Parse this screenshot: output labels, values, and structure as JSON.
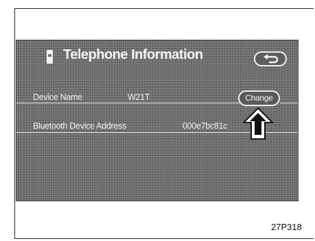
{
  "screen": {
    "title": "Telephone Information",
    "back_icon": "return-arrow-icon"
  },
  "rows": [
    {
      "label": "Device Name",
      "value": "W21T"
    },
    {
      "label": "Bluetooth Device Address",
      "value": "000e7bc81c"
    }
  ],
  "change_button": {
    "label": "Change"
  },
  "caption": "27P318"
}
